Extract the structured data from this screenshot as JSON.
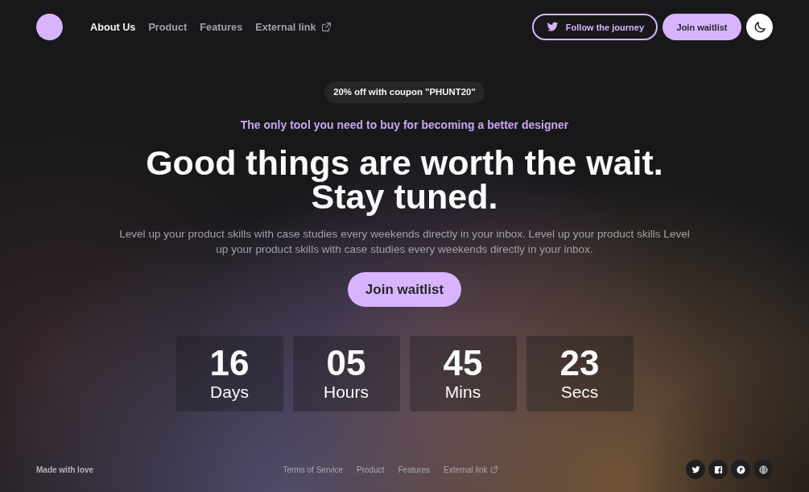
{
  "header": {
    "nav": [
      {
        "label": "About Us",
        "selected": true,
        "external": false
      },
      {
        "label": "Product",
        "selected": false,
        "external": false
      },
      {
        "label": "Features",
        "selected": false,
        "external": false
      },
      {
        "label": "External link",
        "selected": false,
        "external": true
      }
    ],
    "buttons": [
      {
        "label": "Follow the journey",
        "kind": "outline"
      },
      {
        "label": "Join waitlist",
        "kind": "filled"
      }
    ]
  },
  "hero": {
    "badge": "20% off with coupon \"PHUNT20\"",
    "tagline": "The only tool you need to buy for becoming a better designer",
    "headline": [
      "Good things are worth the wait.",
      "Stay tuned."
    ],
    "description": "Level up your product skills with case studies every weekends directly in your inbox. Level up your product skills Level up your product skills with case studies every weekends directly in your inbox.",
    "cta": "Join waitlist"
  },
  "countdown": [
    {
      "value": "16",
      "unit": "Days"
    },
    {
      "value": "05",
      "unit": "Hours"
    },
    {
      "value": "45",
      "unit": "Mins"
    },
    {
      "value": "23",
      "unit": "Secs"
    }
  ],
  "footer": {
    "credit": "Made with love",
    "links": [
      {
        "label": "Terms of Service",
        "external": false
      },
      {
        "label": "Product",
        "external": false
      },
      {
        "label": "Features",
        "external": false
      },
      {
        "label": "External link",
        "external": true
      }
    ]
  }
}
